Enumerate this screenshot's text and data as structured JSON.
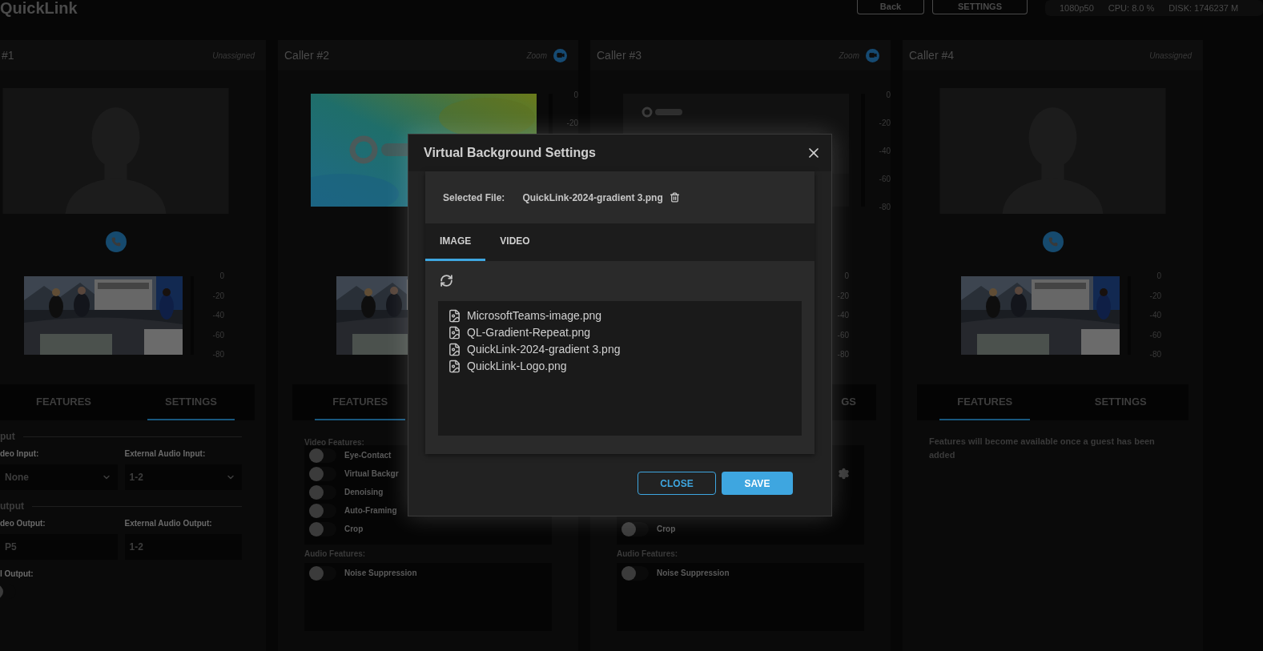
{
  "app": {
    "title": "QuickLink"
  },
  "header": {
    "buttons": [
      "Back",
      "SETTINGS"
    ],
    "stats": [
      "1080p50",
      "CPU: 8.0 %",
      "DISK: 1746237 M"
    ]
  },
  "callers": [
    {
      "title": "#1",
      "partly_visible": true,
      "status": "Unassigned",
      "connected": false,
      "feed": {
        "kind": "placeholder"
      },
      "call_button": true,
      "thumbnail": true,
      "thumb_meter_ticks": [
        "0",
        "-20",
        "-40",
        "-60",
        "-80"
      ],
      "tabs": [
        {
          "kind": "tab",
          "label": "FEATURES",
          "selected": false
        },
        {
          "kind": "tab",
          "label": "SETTINGS",
          "selected": true
        }
      ],
      "panel": {
        "kind": "settings",
        "sections": [
          {
            "title": "put",
            "fields": [
              {
                "label": "deo Input:",
                "value": "None",
                "kind": "select"
              },
              {
                "label": "External Audio Input:",
                "value": "1-2",
                "kind": "select"
              }
            ]
          },
          {
            "title": "utput",
            "fields": [
              {
                "label": "deo Output:",
                "value": "P5",
                "kind": "text"
              },
              {
                "label": "External Audio Output:",
                "value": "1-2",
                "kind": "text"
              }
            ]
          }
        ],
        "toggle": {
          "label": "I Output:",
          "on": false
        }
      }
    },
    {
      "title": "Caller #2",
      "partly_visible": false,
      "status": "Zoom",
      "connected": true,
      "feed": {
        "kind": "picture"
      },
      "feed_meter_ticks": [
        "0",
        "-20"
      ],
      "call_button": false,
      "thumbnail": true,
      "tabs": [
        {
          "kind": "tab",
          "label": "FEATURES",
          "selected": true
        },
        {
          "kind": "covered"
        }
      ],
      "panel": {
        "kind": "features",
        "video_label": "Video Features:",
        "video_features": [
          {
            "kind": "toggle",
            "label": "Eye-Contact",
            "on": false
          },
          {
            "kind": "toggle",
            "label": "Virtual Backgr",
            "on": false
          },
          {
            "kind": "toggle",
            "label": "Denoising",
            "on": false
          },
          {
            "kind": "toggle",
            "label": "Auto-Framing",
            "on": false
          },
          {
            "kind": "toggle",
            "label": "Crop",
            "on": false
          }
        ],
        "audio_label": "Audio Features:",
        "audio_features": [
          {
            "kind": "toggle",
            "label": "Noise Suppression",
            "on": false
          }
        ]
      }
    },
    {
      "title": "Caller #3",
      "partly_visible": false,
      "status": "Zoom",
      "connected": true,
      "feed": {
        "kind": "picture"
      },
      "feed_meter_ticks": [
        "0",
        "-20",
        "-40",
        "-60",
        "-80"
      ],
      "call_button": false,
      "thumbnail": false,
      "thumb_meter_ticks": [
        "0",
        "-20",
        "-40",
        "-60",
        "-80"
      ],
      "tabs": [
        {
          "kind": "covered"
        },
        {
          "kind": "tab_tail",
          "label": "GS",
          "selected": false
        }
      ],
      "panel": {
        "kind": "features",
        "video_features": [
          {
            "kind": "covered"
          },
          {
            "kind": "gear"
          },
          {
            "kind": "covered"
          },
          {
            "kind": "covered"
          },
          {
            "kind": "toggle",
            "label": "Crop",
            "on": false
          }
        ],
        "audio_label": "Audio Features:",
        "audio_features": [
          {
            "kind": "toggle",
            "label": "Noise Suppression",
            "on": false
          }
        ]
      }
    },
    {
      "title": "Caller #4",
      "partly_visible": false,
      "status": "Unassigned",
      "connected": false,
      "feed": {
        "kind": "placeholder"
      },
      "call_button": true,
      "thumbnail": true,
      "thumb_meter_ticks": [
        "0",
        "-20",
        "-40",
        "-60",
        "-80"
      ],
      "tabs": [
        {
          "kind": "tab",
          "label": "FEATURES",
          "selected": true
        },
        {
          "kind": "tab",
          "label": "SETTINGS",
          "selected": false
        }
      ],
      "panel": {
        "kind": "message",
        "text": "Features will become available once a guest has been added"
      }
    }
  ],
  "dialog": {
    "title": "Virtual Background Settings",
    "selected_file_label": "Selected File:",
    "selected_file": "QuickLink-2024-gradient 3.png",
    "tabs": [
      {
        "label": "IMAGE",
        "selected": true
      },
      {
        "label": "VIDEO",
        "selected": false
      }
    ],
    "files": [
      "MicrosoftTeams-image.png",
      "QL-Gradient-Repeat.png",
      "QuickLink-2024-gradient 3.png",
      "QuickLink-Logo.png"
    ],
    "buttons": [
      {
        "label": "CLOSE",
        "kind": "secondary"
      },
      {
        "label": "SAVE",
        "kind": "primary"
      }
    ]
  }
}
